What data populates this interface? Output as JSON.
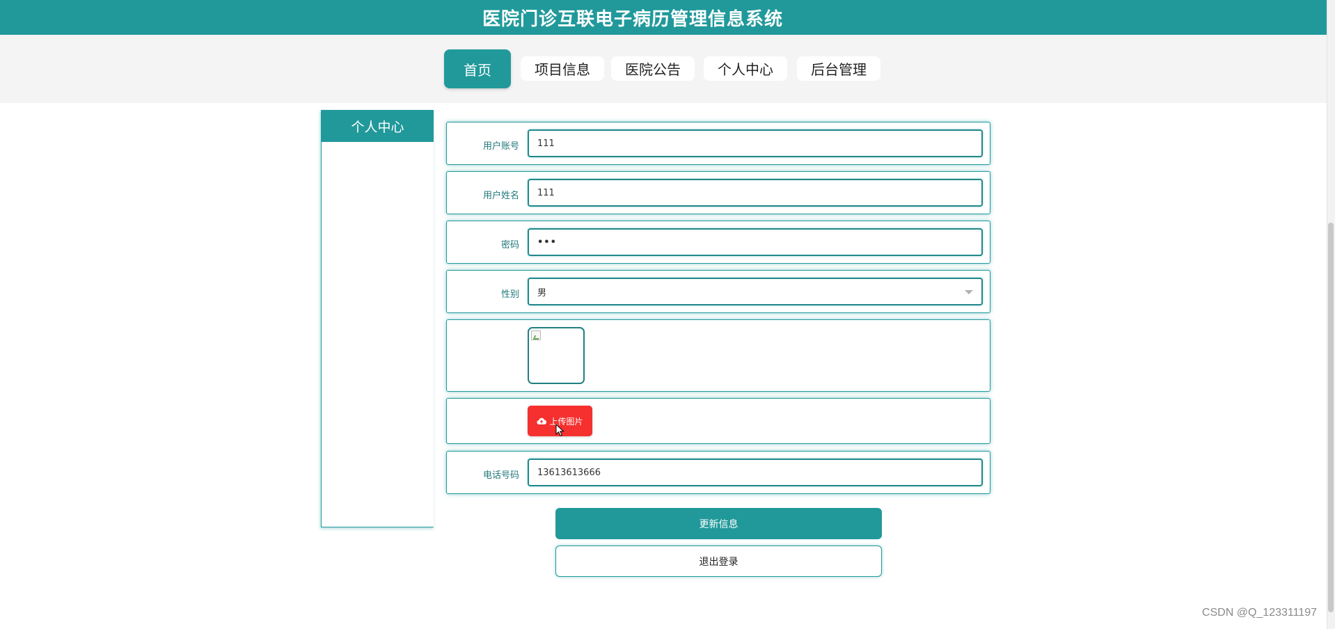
{
  "header": {
    "title": "医院门诊互联电子病历管理信息系统"
  },
  "nav": {
    "items": [
      {
        "label": "首页"
      },
      {
        "label": "项目信息"
      },
      {
        "label": "医院公告"
      },
      {
        "label": "个人中心"
      },
      {
        "label": "后台管理"
      }
    ],
    "active": "首页"
  },
  "sidebar": {
    "title": "个人中心"
  },
  "form": {
    "username": {
      "label": "用户账号",
      "value": "111"
    },
    "realname": {
      "label": "用户姓名",
      "value": "111"
    },
    "password": {
      "label": "密码",
      "value": "•••"
    },
    "gender": {
      "label": "性别",
      "value": "男"
    },
    "upload": {
      "label": "上传图片",
      "icon": "cloud-upload-icon"
    },
    "phone": {
      "label": "电话号码",
      "value": "13613613666"
    }
  },
  "actions": {
    "update_label": "更新信息",
    "logout_label": "退出登录"
  },
  "watermark": "CSDN @Q_123311197",
  "colors": {
    "primary": "#21999b",
    "upload_button": "#f5302f"
  }
}
